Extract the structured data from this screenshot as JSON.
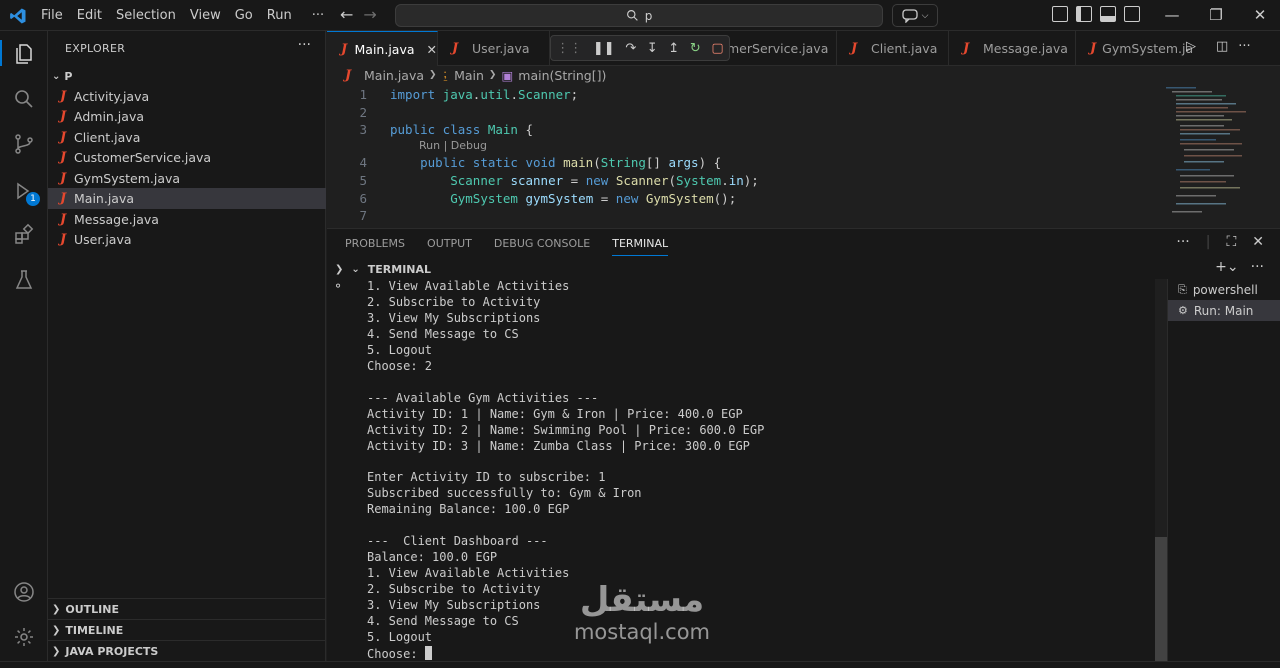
{
  "menu": [
    "File",
    "Edit",
    "Selection",
    "View",
    "Go",
    "Run"
  ],
  "menu_more": "···",
  "search": {
    "text": "p"
  },
  "explorer": {
    "title": "EXPLORER",
    "more": "···",
    "folder": "P",
    "files": [
      "Activity.java",
      "Admin.java",
      "Client.java",
      "CustomerService.java",
      "GymSystem.java",
      "Main.java",
      "Message.java",
      "User.java"
    ],
    "selected": "Main.java",
    "sections": [
      "OUTLINE",
      "TIMELINE",
      "JAVA PROJECTS"
    ]
  },
  "activity_badge": "1",
  "tabs": [
    {
      "label": "Main.java",
      "active": true
    },
    {
      "label": "User.java"
    },
    {
      "label": "merService.java"
    },
    {
      "label": "Client.java"
    },
    {
      "label": "Message.java"
    },
    {
      "label": "GymSystem.ja"
    }
  ],
  "breadcrumbs": [
    "Main.java",
    "Main",
    "main(String[])"
  ],
  "codelens": "Run | Debug",
  "code": {
    "line_numbers": [
      "1",
      "2",
      "3",
      "4",
      "5",
      "6",
      "7"
    ]
  },
  "panel": {
    "tabs": [
      "PROBLEMS",
      "OUTPUT",
      "DEBUG CONSOLE",
      "TERMINAL"
    ],
    "active_tab": "TERMINAL",
    "terminal_header": "TERMINAL",
    "terminals": [
      "powershell",
      "Run: Main"
    ],
    "output": "1. View Available Activities\n2. Subscribe to Activity\n3. View My Subscriptions\n4. Send Message to CS\n5. Logout\nChoose: 2\n\n--- Available Gym Activities ---\nActivity ID: 1 | Name: Gym & Iron | Price: 400.0 EGP\nActivity ID: 2 | Name: Swimming Pool | Price: 600.0 EGP\nActivity ID: 3 | Name: Zumba Class | Price: 300.0 EGP\n\nEnter Activity ID to subscribe: 1\nSubscribed successfully to: Gym & Iron\nRemaining Balance: 100.0 EGP\n\n---  Client Dashboard ---\nBalance: 100.0 EGP\n1. View Available Activities\n2. Subscribe to Activity\n3. View My Subscriptions\n4. Send Message to CS\n5. Logout\nChoose: "
  },
  "watermark": {
    "arabic": "مستقل",
    "latin": "mostaql.com"
  },
  "colors": {
    "accent": "#0078d4",
    "java_icon": "#e5482e",
    "keyword": "#569cd6",
    "type": "#4ec9b0",
    "function": "#dcdcaa",
    "variable": "#9cdcfe"
  }
}
